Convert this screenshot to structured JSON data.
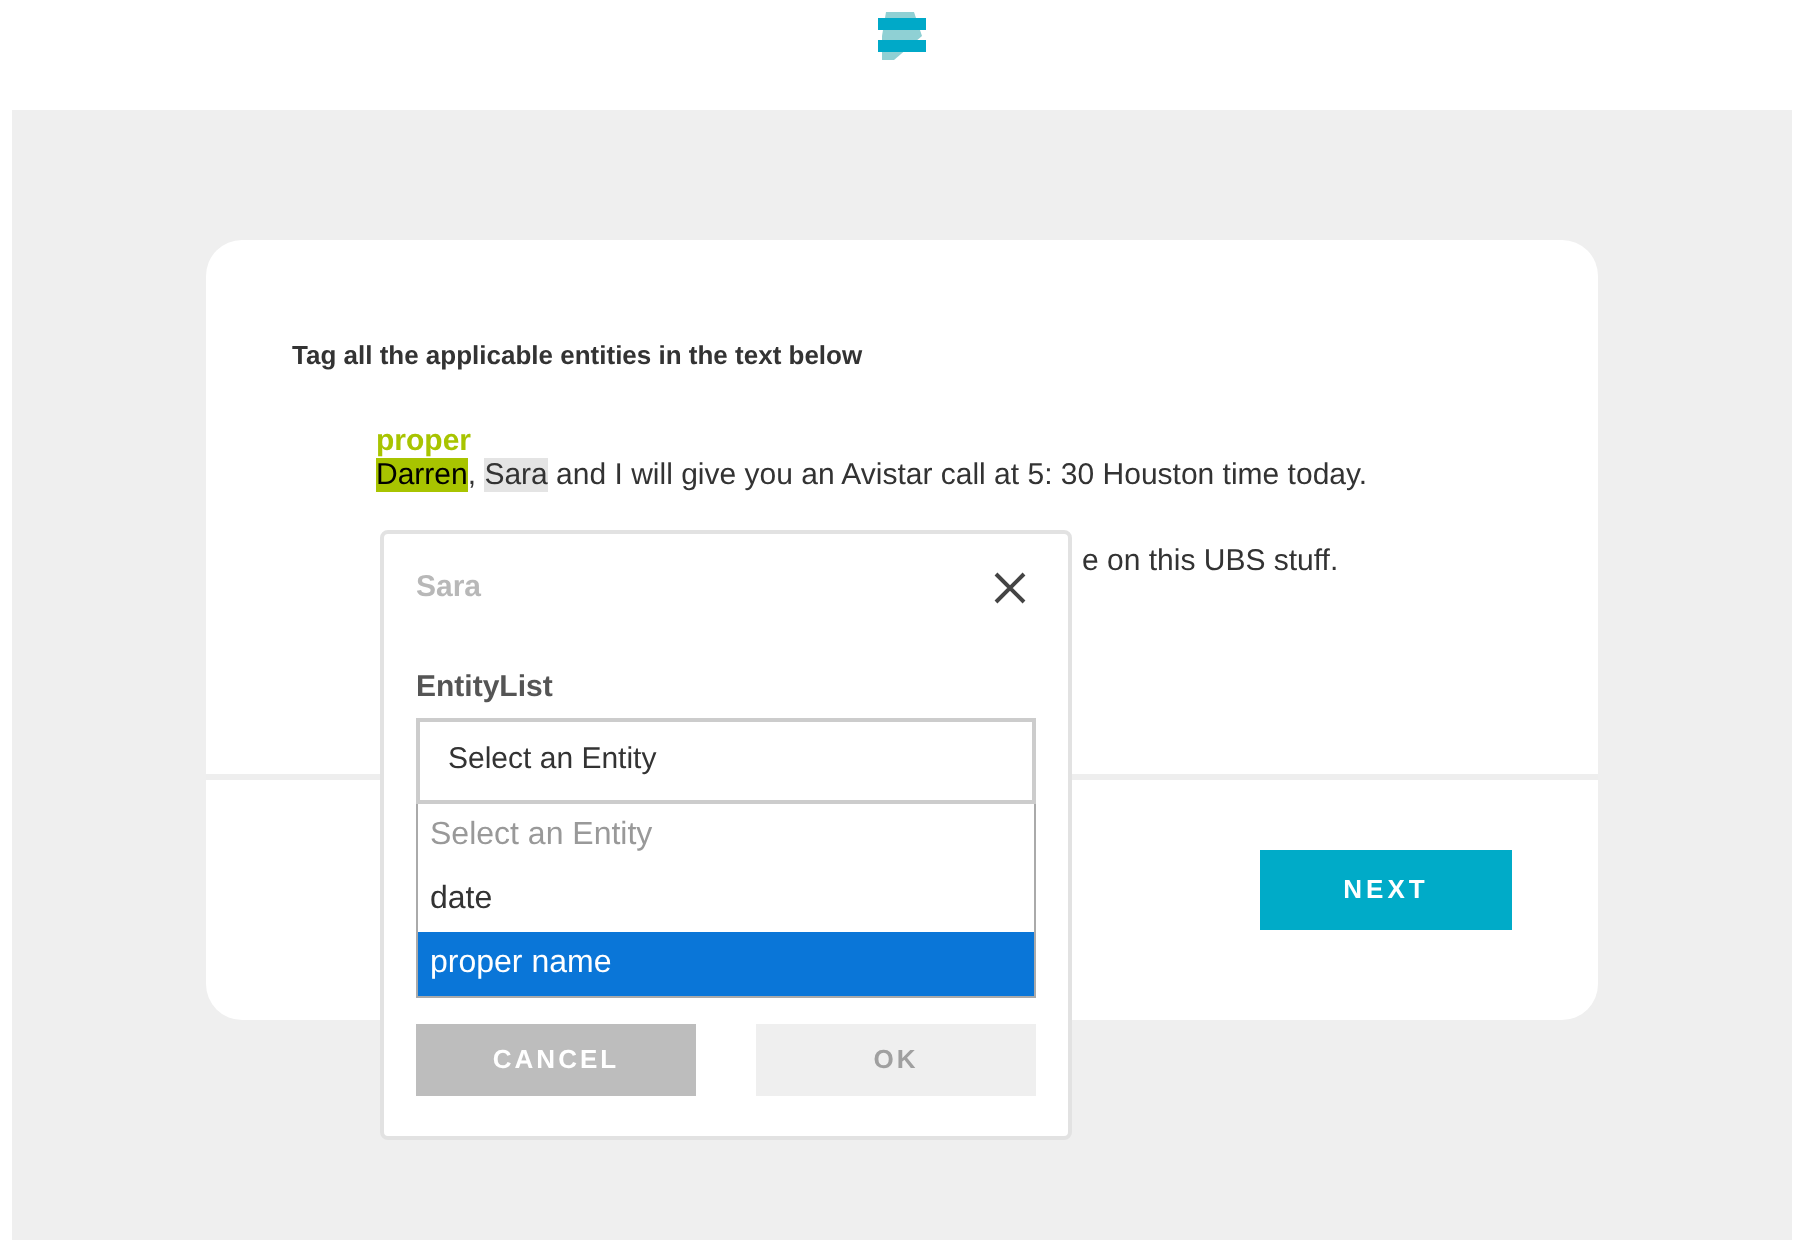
{
  "instruction": "Tag all the applicable entities in the text below",
  "sentence": [
    {
      "text": "Darren",
      "tag": "proper",
      "tagged": true,
      "selected": false
    },
    {
      "text": ", ",
      "tagged": false,
      "selected": false
    },
    {
      "text": "Sara",
      "tagged": false,
      "selected": true
    },
    {
      "text": " and I will give you an Avistar call at 5: 30 Houston time today.",
      "tagged": false,
      "selected": false
    }
  ],
  "sentence_2_visible": "e on this UBS stuff.",
  "next_button": "NEXT",
  "dialog": {
    "title": "Sara",
    "field_label": "EntityList",
    "select_value": "Select an Entity",
    "options": [
      {
        "label": "Select an Entity",
        "disabled": true,
        "selected": false
      },
      {
        "label": "date",
        "disabled": false,
        "selected": false
      },
      {
        "label": "proper name",
        "disabled": false,
        "selected": true
      }
    ],
    "buttons": [
      {
        "label": "CANCEL",
        "disabled": false
      },
      {
        "label": "OK",
        "disabled": true
      }
    ]
  }
}
